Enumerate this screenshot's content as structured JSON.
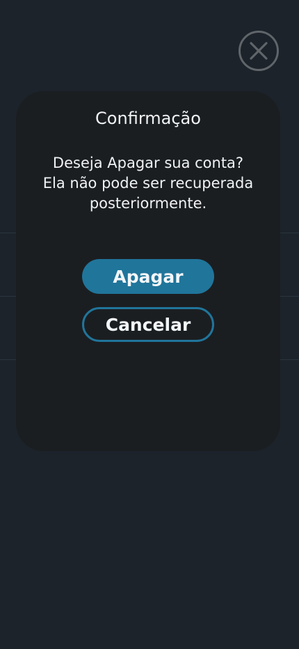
{
  "dialog": {
    "title": "Confirmação",
    "message_line1": "Deseja Apagar sua conta?",
    "message_line2": "Ela não pode ser recuperada",
    "message_line3": "posteriormente.",
    "delete_label": "Apagar",
    "cancel_label": "Cancelar"
  },
  "icons": {
    "close": "close-icon"
  },
  "colors": {
    "background": "#1c232b",
    "modal": "#1b1e21",
    "accent": "#20759b",
    "close_ring": "#5f6569",
    "text": "#f0f2f4"
  }
}
